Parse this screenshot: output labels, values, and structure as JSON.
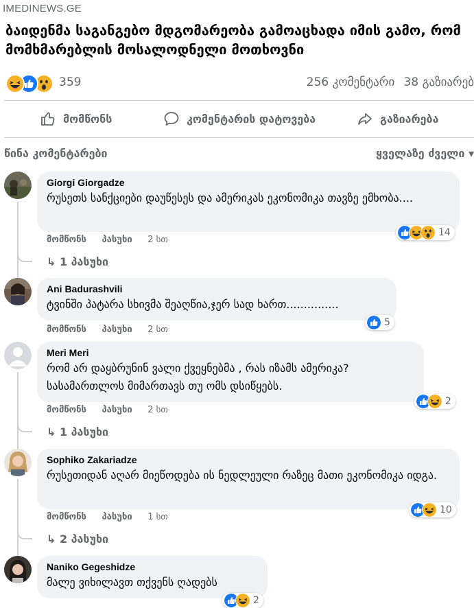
{
  "post": {
    "source": "IMEDINEWS.GE",
    "headline": "ბაიდენმა საგანგებო მდგომარეობა გამოაცხადა იმის გამო, რომ მომხმარებლის მოსალოდნელი მოთხოვნი",
    "reaction_count": "359",
    "comments_count": "256 კომენტარი",
    "shares_count": "38 გაზიარებ"
  },
  "actions": {
    "like": "მომწონს",
    "comment": "კომენტარის დატოვება",
    "share": "გაზიარება"
  },
  "comments_bar": {
    "previous": "წინა კომენტარები",
    "sort": "ყველაზე ძველი ▾"
  },
  "comment_links": {
    "like": "მომწონს",
    "reply": "პასუხი"
  },
  "colors": {
    "like_blue": "#1877f2",
    "haha_yellow": "#f7b125",
    "text_gray": "#65676b",
    "bubble": "#f0f2f5"
  },
  "comments": [
    {
      "author": "Giorgi Giorgadze",
      "text": "რუსეთს სანქციები დაუწესეს და ამერიკას ეკონომიკა თავზე ემხობა....",
      "reactions": "14",
      "time": "2 სთ",
      "replies": "↳ 1 პასუხი"
    },
    {
      "author": "Ani Badurashvili",
      "text": "ტვინში პატარა სხივმა შეაღწია,ჯერ სად ხართ...............",
      "reactions": "5",
      "time": "2 სთ",
      "replies": ""
    },
    {
      "author": "Meri Meri",
      "text": "რომ არ დაყბრუნინ ვალი ქვეყნებმა , რას იზამს ამერიკა? სასამართლოს მიმართავს თუ ომს დსიწყებს.",
      "reactions": "2",
      "time": "2 სთ",
      "replies": "↳ 1 პასუხი"
    },
    {
      "author": "Sophiko Zakariadze",
      "text": "რუსეთიდან აღარ მიეწოდება ის ნედლეული რაზეც მათი ეკონომიკა იდგა.",
      "reactions": "10",
      "time": "1 სთ",
      "replies": "↳ 2 პასუხი"
    },
    {
      "author": "Naniko Gegeshidze",
      "text": "მალე ვიხილავთ თქვენს ღადებს",
      "reactions": "2",
      "time": "",
      "replies": ""
    }
  ]
}
